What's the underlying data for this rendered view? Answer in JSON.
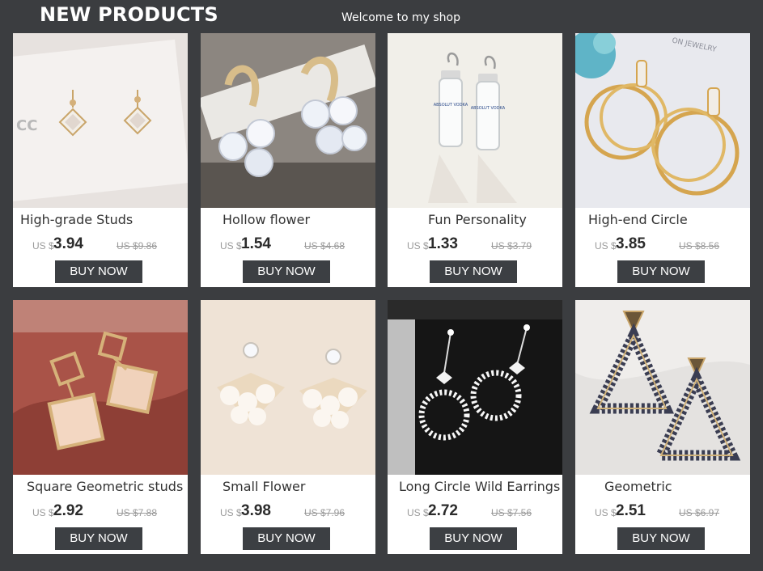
{
  "header": {
    "title": "NEW PRODUCTS",
    "subtitle": "Welcome to my shop"
  },
  "products": [
    {
      "name": "High-grade Studs",
      "currency": "US $",
      "price": "3.94",
      "original_price": "US $9.86",
      "button_label": "BUY NOW"
    },
    {
      "name": "Hollow flower",
      "currency": "US $",
      "price": "1.54",
      "original_price": "US $4.68",
      "button_label": "BUY NOW"
    },
    {
      "name": "Fun Personality",
      "currency": "US $",
      "price": "1.33",
      "original_price": "US $3.79",
      "button_label": "BUY NOW"
    },
    {
      "name": "High-end Circle",
      "currency": "US $",
      "price": "3.85",
      "original_price": "US $8.56",
      "button_label": "BUY NOW"
    },
    {
      "name": "Square Geometric studs",
      "currency": "US $",
      "price": "2.92",
      "original_price": "US $7.88",
      "button_label": "BUY NOW"
    },
    {
      "name": "Small Flower",
      "currency": "US $",
      "price": "3.98",
      "original_price": "US $7.96",
      "button_label": "BUY NOW"
    },
    {
      "name": "Long Circle Wild Earrings",
      "currency": "US $",
      "price": "2.72",
      "original_price": "US $7.56",
      "button_label": "BUY NOW"
    },
    {
      "name": "Geometric",
      "currency": "US $",
      "price": "2.51",
      "original_price": "US $6.97",
      "button_label": "BUY NOW"
    }
  ],
  "photo_labels": {
    "stud_card_logo": "CC",
    "vodka_label_1": "ABSOLUT VODKA",
    "vodka_label_2": "ABSOLUT VODKA",
    "jewelry_card_text": "ON JEWELRY"
  },
  "colors": {
    "background": "#3b3d40",
    "card": "#ffffff",
    "button": "#3c3f43",
    "button_text": "#ffffff",
    "price_text": "#2b2b2b",
    "muted_text": "#9a9a9a"
  }
}
